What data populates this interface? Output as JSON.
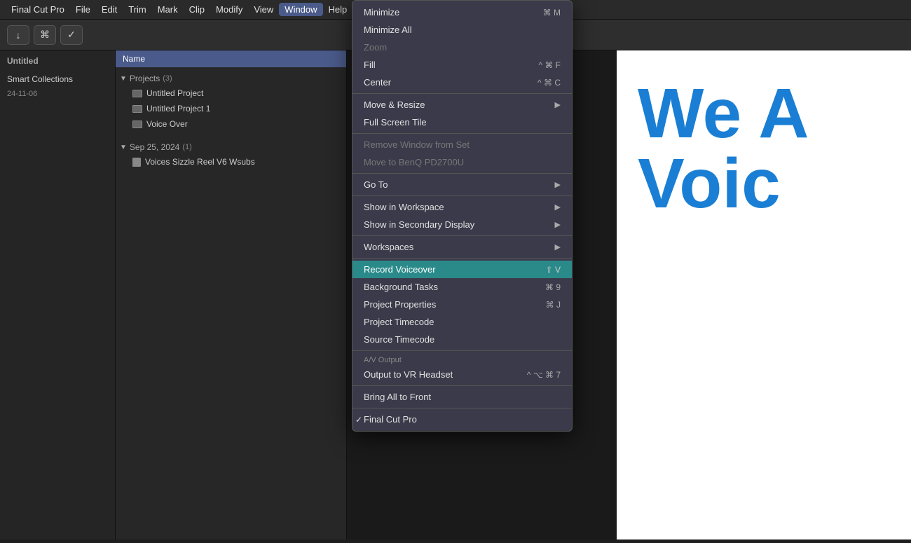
{
  "menubar": {
    "items": [
      {
        "id": "final-cut-pro",
        "label": "Final Cut Pro"
      },
      {
        "id": "file",
        "label": "File"
      },
      {
        "id": "edit",
        "label": "Edit"
      },
      {
        "id": "trim",
        "label": "Trim"
      },
      {
        "id": "mark",
        "label": "Mark"
      },
      {
        "id": "clip",
        "label": "Clip"
      },
      {
        "id": "modify",
        "label": "Modify"
      },
      {
        "id": "view",
        "label": "View"
      },
      {
        "id": "window",
        "label": "Window"
      },
      {
        "id": "help",
        "label": "Help"
      }
    ],
    "active": "Window"
  },
  "toolbar": {
    "import_label": "↓",
    "key_label": "⌘",
    "check_label": "✓"
  },
  "sidebar": {
    "title": "Untitled",
    "smart_collections": "Smart Collections",
    "date": "24-11-06"
  },
  "browser": {
    "header": "Name",
    "projects_label": "Projects",
    "projects_count": "(3)",
    "items": [
      {
        "label": "Untitled Project",
        "type": "film"
      },
      {
        "label": "Untitled Project 1",
        "type": "film"
      },
      {
        "label": "Voice Over",
        "type": "film"
      }
    ],
    "date_section": "Sep 25, 2024",
    "date_count": "(1)",
    "date_items": [
      {
        "label": "Voices Sizzle Reel V6 Wsubs",
        "type": "doc"
      }
    ]
  },
  "preview": {
    "text_we": "We A",
    "text_voic": "Voic"
  },
  "window_menu": {
    "items": [
      {
        "id": "minimize",
        "label": "Minimize",
        "shortcut": "⌘ M",
        "disabled": false,
        "has_arrow": false,
        "is_separator": false
      },
      {
        "id": "minimize-all",
        "label": "Minimize All",
        "shortcut": "",
        "disabled": false,
        "has_arrow": false,
        "is_separator": false
      },
      {
        "id": "zoom",
        "label": "Zoom",
        "shortcut": "",
        "disabled": true,
        "has_arrow": false,
        "is_separator": false
      },
      {
        "id": "fill",
        "label": "Fill",
        "shortcut": "^ ⌘ F",
        "disabled": false,
        "has_arrow": false,
        "is_separator": false
      },
      {
        "id": "center",
        "label": "Center",
        "shortcut": "^ ⌘ C",
        "disabled": false,
        "has_arrow": false,
        "is_separator": false
      },
      {
        "id": "sep1",
        "is_separator": true
      },
      {
        "id": "move-resize",
        "label": "Move & Resize",
        "shortcut": "",
        "disabled": false,
        "has_arrow": true,
        "is_separator": false
      },
      {
        "id": "full-screen-tile",
        "label": "Full Screen Tile",
        "shortcut": "",
        "disabled": false,
        "has_arrow": false,
        "is_separator": false
      },
      {
        "id": "sep2",
        "is_separator": true
      },
      {
        "id": "remove-window",
        "label": "Remove Window from Set",
        "shortcut": "",
        "disabled": true,
        "has_arrow": false,
        "is_separator": false
      },
      {
        "id": "move-to-benq",
        "label": "Move to BenQ PD2700U",
        "shortcut": "",
        "disabled": true,
        "has_arrow": false,
        "is_separator": false
      },
      {
        "id": "sep3",
        "is_separator": true
      },
      {
        "id": "go-to",
        "label": "Go To",
        "shortcut": "",
        "disabled": false,
        "has_arrow": true,
        "is_separator": false
      },
      {
        "id": "sep4",
        "is_separator": true
      },
      {
        "id": "show-workspace",
        "label": "Show in Workspace",
        "shortcut": "",
        "disabled": false,
        "has_arrow": true,
        "is_separator": false
      },
      {
        "id": "show-secondary",
        "label": "Show in Secondary Display",
        "shortcut": "",
        "disabled": false,
        "has_arrow": true,
        "is_separator": false
      },
      {
        "id": "sep5",
        "is_separator": true
      },
      {
        "id": "workspaces",
        "label": "Workspaces",
        "shortcut": "",
        "disabled": false,
        "has_arrow": true,
        "is_separator": false
      },
      {
        "id": "sep6",
        "is_separator": true
      },
      {
        "id": "record-voiceover",
        "label": "Record Voiceover",
        "shortcut": "⇧ V",
        "disabled": false,
        "has_arrow": false,
        "is_separator": false,
        "highlighted": true
      },
      {
        "id": "background-tasks",
        "label": "Background Tasks",
        "shortcut": "⌘ 9",
        "disabled": false,
        "has_arrow": false,
        "is_separator": false
      },
      {
        "id": "project-properties",
        "label": "Project Properties",
        "shortcut": "⌘ J",
        "disabled": false,
        "has_arrow": false,
        "is_separator": false
      },
      {
        "id": "project-timecode",
        "label": "Project Timecode",
        "shortcut": "",
        "disabled": false,
        "has_arrow": false,
        "is_separator": false
      },
      {
        "id": "source-timecode",
        "label": "Source Timecode",
        "shortcut": "",
        "disabled": false,
        "has_arrow": false,
        "is_separator": false
      },
      {
        "id": "sep7",
        "is_separator": true
      },
      {
        "id": "av-output-header",
        "label": "A/V Output",
        "is_section": true,
        "is_separator": false
      },
      {
        "id": "output-vr",
        "label": "Output to VR Headset",
        "shortcut": "^ ⌥ ⌘ 7",
        "disabled": false,
        "has_arrow": false,
        "is_separator": false
      },
      {
        "id": "sep8",
        "is_separator": true
      },
      {
        "id": "bring-all-front",
        "label": "Bring All to Front",
        "shortcut": "",
        "disabled": false,
        "has_arrow": false,
        "is_separator": false
      },
      {
        "id": "sep9",
        "is_separator": true
      },
      {
        "id": "final-cut-pro-win",
        "label": "Final Cut Pro",
        "shortcut": "",
        "disabled": false,
        "has_arrow": false,
        "is_separator": false,
        "checked": true
      }
    ]
  }
}
